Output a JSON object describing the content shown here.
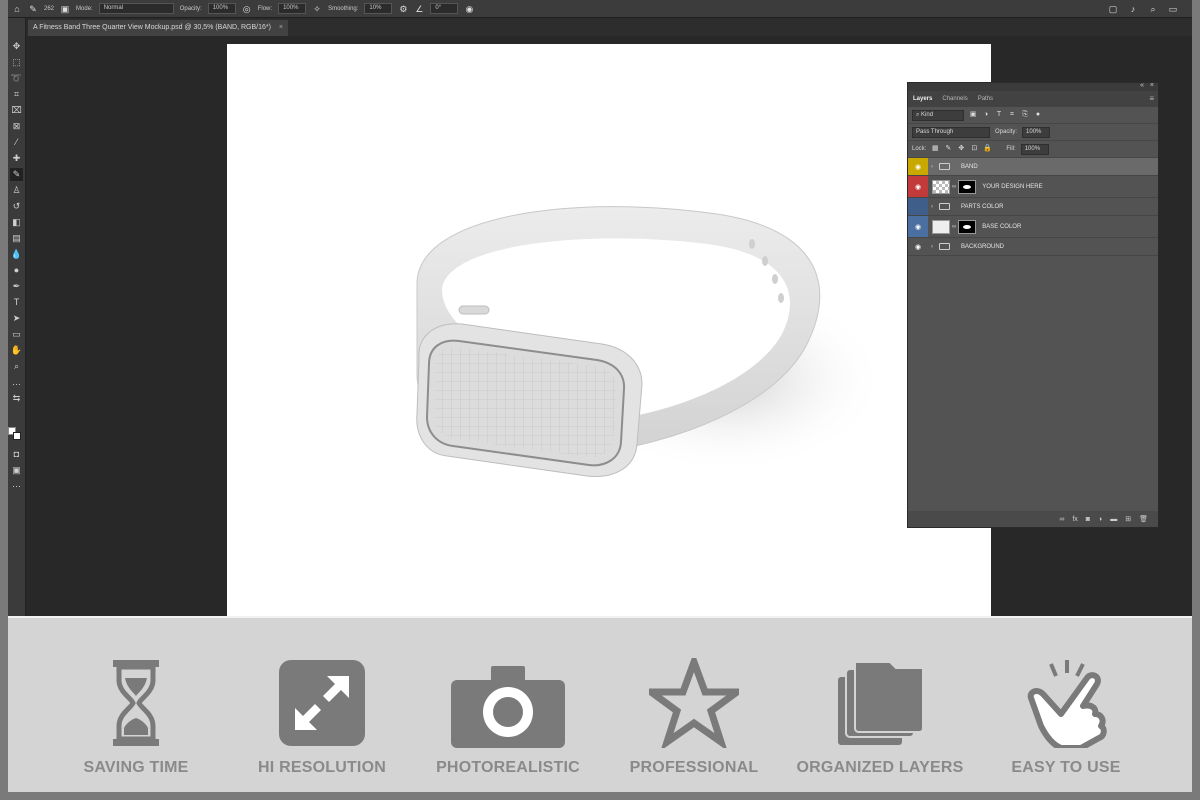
{
  "options_bar": {
    "brush_size": "262",
    "mode_label": "Mode:",
    "mode_value": "Normal",
    "opacity_label": "Opacity:",
    "opacity_value": "100%",
    "flow_label": "Flow:",
    "flow_value": "100%",
    "smoothing_label": "Smoothing:",
    "smoothing_value": "10%",
    "angle_value": "0°"
  },
  "document_tab": {
    "title": "A Fitness Band Three Quarter View Mockup.psd @ 30,5% (BAND, RGB/16*)",
    "close": "×"
  },
  "layers_panel": {
    "tabs": [
      "Layers",
      "Channels",
      "Paths"
    ],
    "filter_kind": "Kind",
    "blend_mode": "Pass Through",
    "opacity_label": "Opacity:",
    "opacity_value": "100%",
    "lock_label": "Lock:",
    "fill_label": "Fill:",
    "fill_value": "100%",
    "layers": [
      {
        "name": "BAND",
        "color": "#c9a800",
        "type": "group"
      },
      {
        "name": "YOUR DESIGN HERE",
        "color": "#c23a3a",
        "type": "smart-object"
      },
      {
        "name": "PARTS COLOR",
        "color": "#3f5f8a",
        "type": "group"
      },
      {
        "name": "BASE COLOR",
        "color": "#4a6fa0",
        "type": "layer"
      },
      {
        "name": "BACKGROUND",
        "color": "#535353",
        "type": "group"
      }
    ]
  },
  "features": [
    {
      "label": "SAVING TIME",
      "icon": "hourglass-icon"
    },
    {
      "label": "HI RESOLUTION",
      "icon": "expand-icon"
    },
    {
      "label": "PHOTOREALISTIC",
      "icon": "camera-icon"
    },
    {
      "label": "PROFESSIONAL",
      "icon": "star-icon"
    },
    {
      "label": "ORGANIZED LAYERS",
      "icon": "stacked-folders-icon"
    },
    {
      "label": "EASY TO USE",
      "icon": "tap-hand-icon"
    }
  ],
  "colors": {
    "feature_icon": "#7a7a7a",
    "feature_label": "#8a8a8a",
    "feature_bg": "#d4d4d4"
  }
}
